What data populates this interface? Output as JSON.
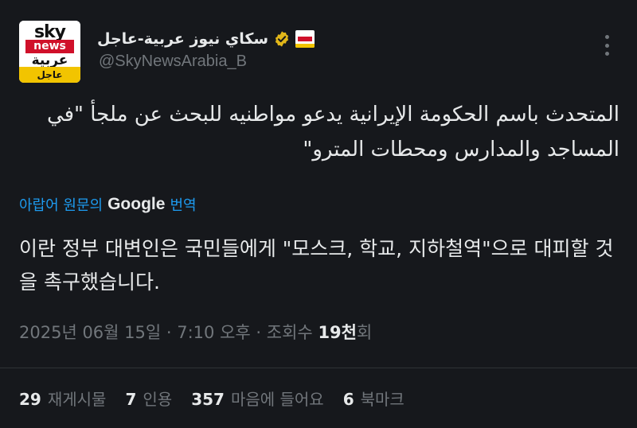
{
  "avatar": {
    "brand_top": "sky",
    "brand_mid": "news",
    "brand_arabic": "عربية",
    "brand_band": "عاجل"
  },
  "account": {
    "display_name": "سكاي نيوز عربية-عاجل",
    "handle": "@SkyNewsArabia_B",
    "verified_color": "#e2b719"
  },
  "tweet": {
    "text": "المتحدث باسم الحكومة الإيرانية يدعو مواطنيه للبحث عن ملجأ \"في المساجد والمدارس ومحطات المترو\"",
    "translation_prefix": "아랍어 원문의",
    "translation_provider": "Google",
    "translation_suffix": "번역",
    "translated_text": "이란 정부 대변인은 국민들에게 \"모스크, 학교, 지하철역\"으로 대피할 것을 촉구했습니다."
  },
  "meta": {
    "date": "2025년 06월 15일",
    "time": "7:10 오후",
    "views_label": "조회수",
    "views_count": "19천",
    "views_suffix": "회"
  },
  "stats": [
    {
      "count": "29",
      "label": "재게시물"
    },
    {
      "count": "7",
      "label": "인용"
    },
    {
      "count": "357",
      "label": "마음에 들어요"
    },
    {
      "count": "6",
      "label": "북마크"
    }
  ],
  "colors": {
    "background": "#16181c",
    "link": "#1d9bf0",
    "muted": "#71767b",
    "text": "#e7e9ea"
  }
}
